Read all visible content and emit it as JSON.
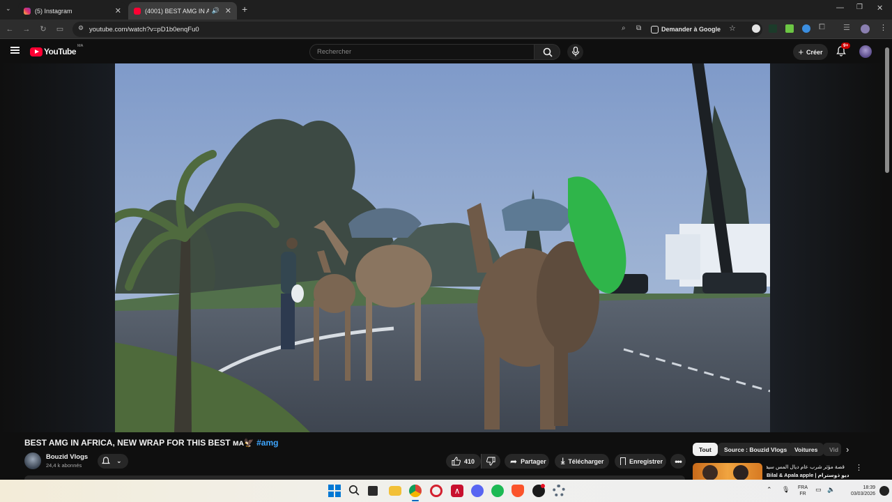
{
  "browser": {
    "tabs": [
      {
        "label": "(5) Instagram",
        "favicon": "instagram-icon",
        "active": false
      },
      {
        "label": "(4001) BEST AMG IN AFRIC",
        "favicon": "youtube-icon",
        "active": true
      }
    ],
    "url": "youtube.com/watch?v=pD1b0enqFu0",
    "ask_google": "Demander à Google"
  },
  "youtube": {
    "logo_text": "YouTube",
    "country_code": "MA",
    "search_placeholder": "Rechercher",
    "create_label": "Créer",
    "notification_count": "9+"
  },
  "video": {
    "title": "BEST AMG IN AFRICA, NEW WRAP FOR THIS BEST ᴍᴀ🦅",
    "hashtag": "#amg",
    "channel_name": "Bouzid Vlogs",
    "subscribers": "24,4 k abonnés",
    "likes": "410",
    "share_label": "Partager",
    "download_label": "Télécharger",
    "save_label": "Enregistrer"
  },
  "chips": [
    {
      "label": "Tout",
      "active": true
    },
    {
      "label": "Source : Bouzid Vlogs",
      "active": false
    },
    {
      "label": "Voitures",
      "active": false
    },
    {
      "label": "Vid",
      "active": false
    }
  ],
  "recommendation": {
    "title_line1": "قصة مؤثر شرب عام ديال المس سيف",
    "title_line2": "Bilal & Apala apple | فيديو ذوسترام"
  },
  "taskbar": {
    "lang_top": "FRA",
    "lang_bottom": "FR",
    "time": "18:39",
    "date": "03/03/2026"
  },
  "colors": {
    "accent_red": "#ff0033",
    "link_blue": "#3ea6ff",
    "background": "#0f0f0f"
  }
}
